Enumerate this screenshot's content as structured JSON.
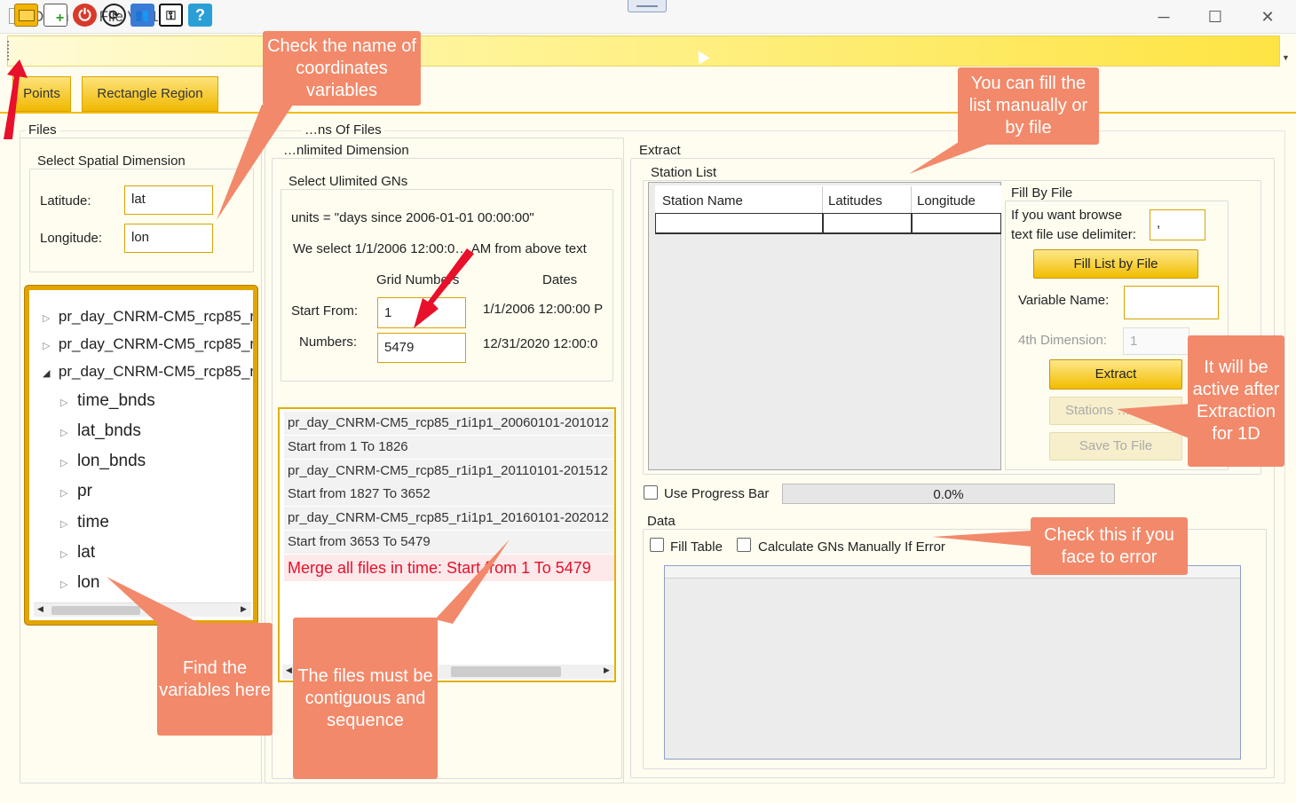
{
  "window": {
    "title": "Open NC File V1.1",
    "minimize": "─",
    "maximize": "☐",
    "close": "✕"
  },
  "toolbar": {
    "icons": [
      "open-folder-icon",
      "add-file-icon",
      "power-icon",
      "refresh-icon",
      "users-icon",
      "key-icon",
      "help-icon"
    ]
  },
  "tabs": [
    "Points",
    "Rectangle Region"
  ],
  "files": {
    "group_title": "Files",
    "spatial": {
      "title": "Select Spatial Dimension",
      "lat_label": "Latitude:",
      "lat_value": "lat",
      "lon_label": "Longitude:",
      "lon_value": "lon"
    },
    "tree": {
      "files": [
        "pr_day_CNRM-CM5_rcp85_r",
        "pr_day_CNRM-CM5_rcp85_r",
        "pr_day_CNRM-CM5_rcp85_r"
      ],
      "children": [
        "time_bnds",
        "lat_bnds",
        "lon_bnds",
        "pr",
        "time",
        "lat",
        "lon"
      ]
    }
  },
  "gns": {
    "group_title": "…ns Of Files",
    "unlimited_title": "…nlimited Dimension",
    "select_title": "Select Ulimited GNs",
    "units": "units = \"days since 2006-01-01 00:00:00\"",
    "select_text": "We select 1/1/2006 12:00:0… AM from above text",
    "col_grid": "Grid Numbers",
    "col_dates": "Dates",
    "start_label": "Start From:",
    "start_value": "1",
    "start_date": "1/1/2006 12:00:00 P",
    "numbers_label": "Numbers:",
    "numbers_value": "5479",
    "end_date": "12/31/2020 12:00:0",
    "list": [
      "pr_day_CNRM-CM5_rcp85_r1i1p1_20060101-201012",
      "Start from 1 To 1826",
      "pr_day_CNRM-CM5_rcp85_r1i1p1_20110101-201512",
      "Start from 1827 To 3652",
      "pr_day_CNRM-CM5_rcp85_r1i1p1_20160101-202012",
      "Start from 3653 To 5479"
    ],
    "merge": "Merge all files in time: Start from 1 To 5479"
  },
  "extract": {
    "group_title": "Extract",
    "station_title": "Station List",
    "cols": [
      "Station Name",
      "Latitudes",
      "Longitude"
    ],
    "fill_title": "Fill By File",
    "fill_text_1": "If you want browse",
    "fill_text_2": "text file use delimiter:",
    "delimiter": ",",
    "fill_btn": "Fill List by File",
    "var_label": "Variable Name:",
    "var_value": "",
    "dim_label": "4th Dimension:",
    "dim_value": "1",
    "extract_btn": "Extract",
    "stations_btn": "Stations …",
    "save_btn": "Save To File",
    "progress_label": "Use Progress Bar",
    "progress_value": "0.0%",
    "progress_fraction": 0.0,
    "data_title": "Data",
    "fill_table": "Fill Table",
    "calc_gns": "Calculate GNs Manually If Error"
  },
  "callouts": {
    "coords": "Check the name of coordinates variables",
    "fill": "You can fill the list manually or by file",
    "active": "It will be active after Extraction for 1D",
    "error": "Check this if you face to error",
    "vars": "Find the variables here",
    "contig": "The files must be contiguous and sequence"
  },
  "colors": {
    "accent": "#f0b800",
    "callout": "#f2896a",
    "merge": "#e8102a"
  }
}
